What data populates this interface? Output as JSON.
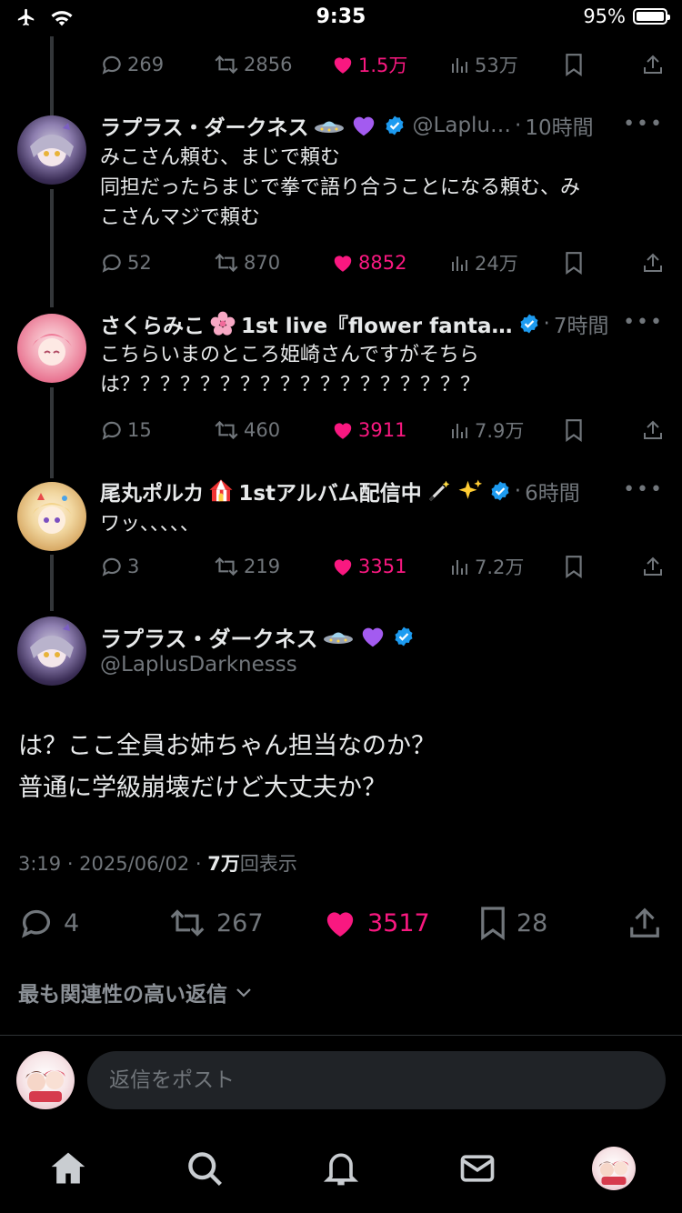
{
  "status": {
    "time": "9:35",
    "battery": "95%"
  },
  "tweets": [
    {
      "stats": {
        "replies": "269",
        "retweets": "2856",
        "likes": "1.5万",
        "views": "53万"
      }
    },
    {
      "name": "ラプラス・ダークネス",
      "handle": "@Laplu…",
      "ago": "10時間",
      "text_lines": [
        "みこさん頼む、まじで頼む",
        "同担だったらまじで拳で語り合うことになる頼む、み",
        "こさんマジで頼む"
      ],
      "stats": {
        "replies": "52",
        "retweets": "870",
        "likes": "8852",
        "views": "24万"
      }
    },
    {
      "name": "さくらみこ",
      "name_suffix": "1st live『flower fanta…",
      "ago": "7時間",
      "text_lines": [
        "こちらいまのところ姫崎さんですがそちら",
        "は？？？？？？？？？？？？？？？？？？"
      ],
      "stats": {
        "replies": "15",
        "retweets": "460",
        "likes": "3911",
        "views": "7.9万"
      }
    },
    {
      "name": "尾丸ポルカ",
      "name_suffix": "1stアルバム配信中",
      "ago": "6時間",
      "text_lines": [
        "ワッ、、、、、"
      ],
      "stats": {
        "replies": "3",
        "retweets": "219",
        "likes": "3351",
        "views": "7.2万"
      }
    }
  ],
  "main": {
    "name": "ラプラス・ダークネス",
    "handle": "@LaplusDarknesss",
    "text_lines": [
      "は？ここ全員お姉ちゃん担当なのか？",
      "普通に学級崩壊だけど大丈夫か？"
    ],
    "time": "3:19 · 2025/06/02 · ",
    "views_count": "7万",
    "views_label": "回表示",
    "stats": {
      "replies": "4",
      "retweets": "267",
      "likes": "3517",
      "bookmarks": "28"
    }
  },
  "sort_label": "最も関連性の高い返信",
  "reply_placeholder": "返信をポスト",
  "colors": {
    "like": "#f91880",
    "verified": "#1d9bf0",
    "muted": "#71767b",
    "background": "#000000"
  },
  "icons": [
    "airplane-icon",
    "wifi-icon",
    "comment-icon",
    "retweet-icon",
    "heart-icon",
    "views-icon",
    "bookmark-icon",
    "share-icon",
    "more-icon",
    "verified-icon",
    "chevron-down-icon",
    "home-icon",
    "search-icon",
    "bell-icon",
    "mail-icon"
  ]
}
